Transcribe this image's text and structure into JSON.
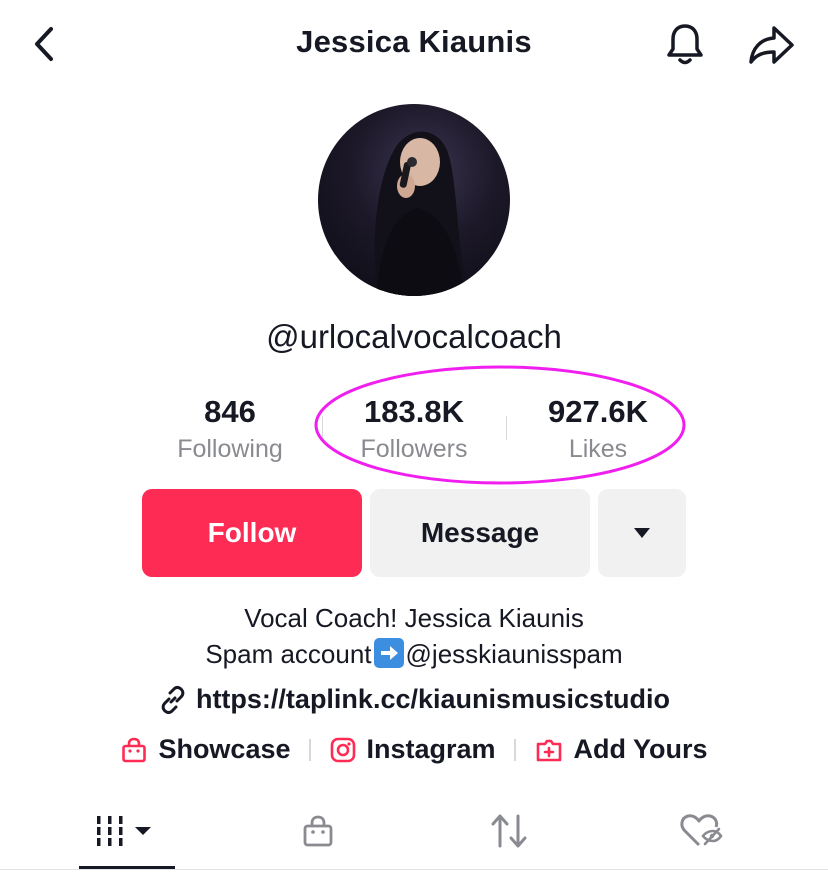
{
  "header": {
    "title": "Jessica Kiaunis"
  },
  "profile": {
    "username": "@urlocalvocalcoach",
    "stats": {
      "following": {
        "value": "846",
        "label": "Following"
      },
      "followers": {
        "value": "183.8K",
        "label": "Followers"
      },
      "likes": {
        "value": "927.6K",
        "label": "Likes"
      }
    }
  },
  "actions": {
    "follow_label": "Follow",
    "message_label": "Message"
  },
  "bio": {
    "line1": "Vocal Coach! Jessica Kiaunis",
    "line2_before": "Spam account",
    "line2_after": "@jesskiaunisspam",
    "link": "https://taplink.cc/kiaunismusicstudio"
  },
  "links": [
    {
      "label": "Showcase",
      "icon": "shopping-bag-icon"
    },
    {
      "label": "Instagram",
      "icon": "instagram-icon"
    },
    {
      "label": "Add Yours",
      "icon": "add-yours-icon"
    }
  ],
  "tabs": [
    {
      "name": "videos",
      "icon": "grid-icon",
      "active": true
    },
    {
      "name": "shop",
      "icon": "shopping-bag-icon"
    },
    {
      "name": "reposts",
      "icon": "repost-icon"
    },
    {
      "name": "liked",
      "icon": "hidden-heart-icon"
    }
  ],
  "colors": {
    "accent": "#fe2c55",
    "highlight": "#f01ff0",
    "text": "#161823",
    "secondary_text": "#8a8b91",
    "button_gray": "#f1f1f2"
  }
}
